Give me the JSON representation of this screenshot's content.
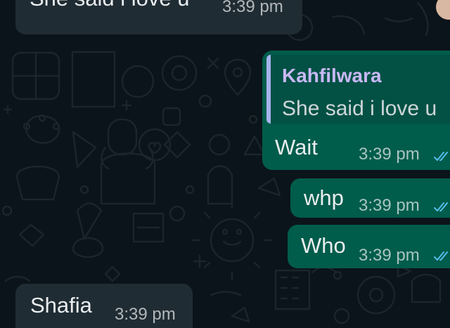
{
  "messages": [
    {
      "type": "incoming",
      "text": "She said i love u",
      "time": "3:39 pm"
    },
    {
      "type": "outgoing_reply",
      "quote_author": "Kahfilwara",
      "quote_text": "She said i love u",
      "text": "Wait",
      "time": "3:39 pm",
      "status": "read"
    },
    {
      "type": "outgoing",
      "text": "whp",
      "time": "3:39 pm",
      "status": "read"
    },
    {
      "type": "outgoing",
      "text": "Who",
      "time": "3:39 pm",
      "status": "read"
    },
    {
      "type": "incoming",
      "text": "Shafia",
      "time": "3:39 pm"
    }
  ],
  "colors": {
    "background": "#0b141a",
    "incoming_bubble": "#202c33",
    "outgoing_bubble": "#005c4b",
    "quote_bar": "#a5b4ec",
    "quote_author": "#c8b8f4",
    "read_ticks": "#53bdeb"
  },
  "icons": [
    "double-check-icon",
    "avatar"
  ]
}
